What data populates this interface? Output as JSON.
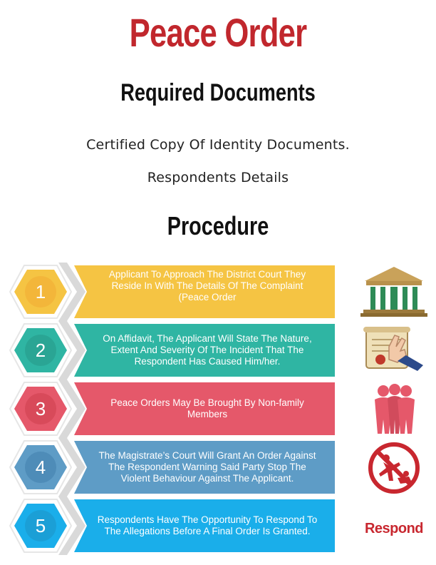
{
  "title": "Peace Order",
  "required_heading": "Required Documents",
  "documents": [
    "Certified Copy Of Identity Documents.",
    "Respondents Details"
  ],
  "procedure_heading": "Procedure",
  "steps": [
    {
      "number": "1",
      "text": "Applicant To Approach The District Court They Reside In With The Details Of The Complaint (Peace Order",
      "color": "#f5c443",
      "circle": "#f3b63a",
      "icon": "courthouse-icon"
    },
    {
      "number": "2",
      "text": "On Affidavit, The Applicant Will State The Nature, Extent And Severity Of The Incident That The Respondent Has Caused Him/her.",
      "color": "#2fb5a3",
      "circle": "#2aa594",
      "icon": "affidavit-oath-icon"
    },
    {
      "number": "3",
      "text": "Peace Orders May Be Brought By Non-family Members",
      "color": "#e5586a",
      "circle": "#d84a5a",
      "icon": "people-group-icon"
    },
    {
      "number": "4",
      "text": "The Magistrate’s Court Will Grant An Order Against The Respondent Warning Said Party Stop The Violent Behaviour Against The Applicant.",
      "color": "#5e9cc6",
      "circle": "#4e8cb8",
      "icon": "no-violence-icon"
    },
    {
      "number": "5",
      "text": "Respondents Have The Opportunity To Respond To The Allegations Before A Final Order Is Granted.",
      "color": "#1aaeea",
      "circle": "#1b9fd6",
      "icon": "respond-text-icon",
      "icon_text": "Respond"
    }
  ]
}
